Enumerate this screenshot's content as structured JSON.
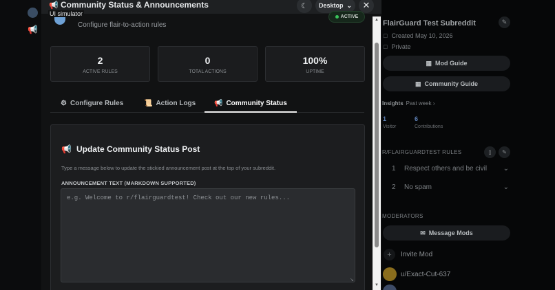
{
  "header": {
    "title": "Community Status & Announcements",
    "sim_label": "UI simulator",
    "device": "Desktop"
  },
  "app": {
    "subtitle": "Configure flair-to-action rules",
    "status_badge": "ACTIVE",
    "stats": [
      {
        "value": "2",
        "label": "ACTIVE RULES"
      },
      {
        "value": "0",
        "label": "TOTAL ACTIONS"
      },
      {
        "value": "100%",
        "label": "UPTIME"
      }
    ],
    "tabs": [
      {
        "label": "Configure Rules",
        "icon": "gear-icon"
      },
      {
        "label": "Action Logs",
        "icon": "scroll-icon"
      },
      {
        "label": "Community Status",
        "icon": "megaphone-icon"
      }
    ],
    "active_tab": "Community Status"
  },
  "status_card": {
    "title": "Update Community Status Post",
    "description": "Type a message below to update the stickied announcement post at the top of your subreddit.",
    "field_label": "ANNOUNCEMENT TEXT (MARKDOWN SUPPORTED)",
    "placeholder": "e.g. Welcome to r/flairguardtest! Check out our new rules..."
  },
  "sidebar": {
    "subreddit_title": "FlairGuard Test Subreddit",
    "created": "Created May 10, 2026",
    "privacy": "Private",
    "mod_guide": "Mod Guide",
    "community_guide": "Community Guide",
    "insights_label": "Insights",
    "insights_range": "Past week",
    "visitors_value": "1",
    "visitors_label": "Visitor",
    "contrib_value": "6",
    "contrib_label": "Contributions",
    "rules_heading": "R/FLAIRGUARDTEST RULES",
    "rules": [
      {
        "num": "1",
        "text": "Respect others and be civil"
      },
      {
        "num": "2",
        "text": "No spam"
      }
    ],
    "moderators_heading": "MODERATORS",
    "message_mods": "Message Mods",
    "invite_mod": "Invite Mod",
    "moderator_name": "u/Exact-Cut-637"
  },
  "colors": {
    "accent_megaphone": "#e0566a",
    "active_green": "#39c35a",
    "link_blue": "#5f82b8"
  }
}
